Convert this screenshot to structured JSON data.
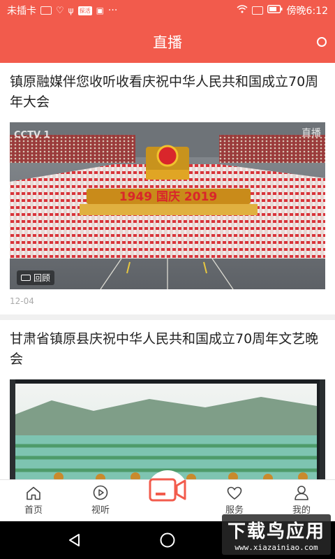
{
  "status_bar": {
    "carrier": "未插卡",
    "badge": "探活",
    "more": "···",
    "time": "傍晚6:12"
  },
  "header": {
    "title": "直播"
  },
  "feed": [
    {
      "title": "镇原融媒伴您收听收看庆祝中华人民共和国成立70周年大会",
      "replay_label": "回顾",
      "image_text_left": "CCTV 1",
      "image_text_right": "直播",
      "banner_text": "1949 国庆 2019",
      "date": "12-04"
    },
    {
      "title": "甘肃省镇原县庆祝中华人民共和国成立70周年文艺晚会"
    }
  ],
  "tabbar": {
    "tabs": [
      {
        "label": "首页",
        "icon": "home-icon"
      },
      {
        "label": "视听",
        "icon": "play-circle-icon"
      },
      {
        "label": "",
        "icon": "video-camera-icon"
      },
      {
        "label": "服务",
        "icon": "heart-icon"
      },
      {
        "label": "我的",
        "icon": "user-icon"
      }
    ]
  },
  "watermark": {
    "line1": "下载鸟应用",
    "line2": "www.xiazainiao.com"
  },
  "colors": {
    "accent": "#f25b4c",
    "text": "#222222",
    "muted": "#aaaaaa"
  }
}
